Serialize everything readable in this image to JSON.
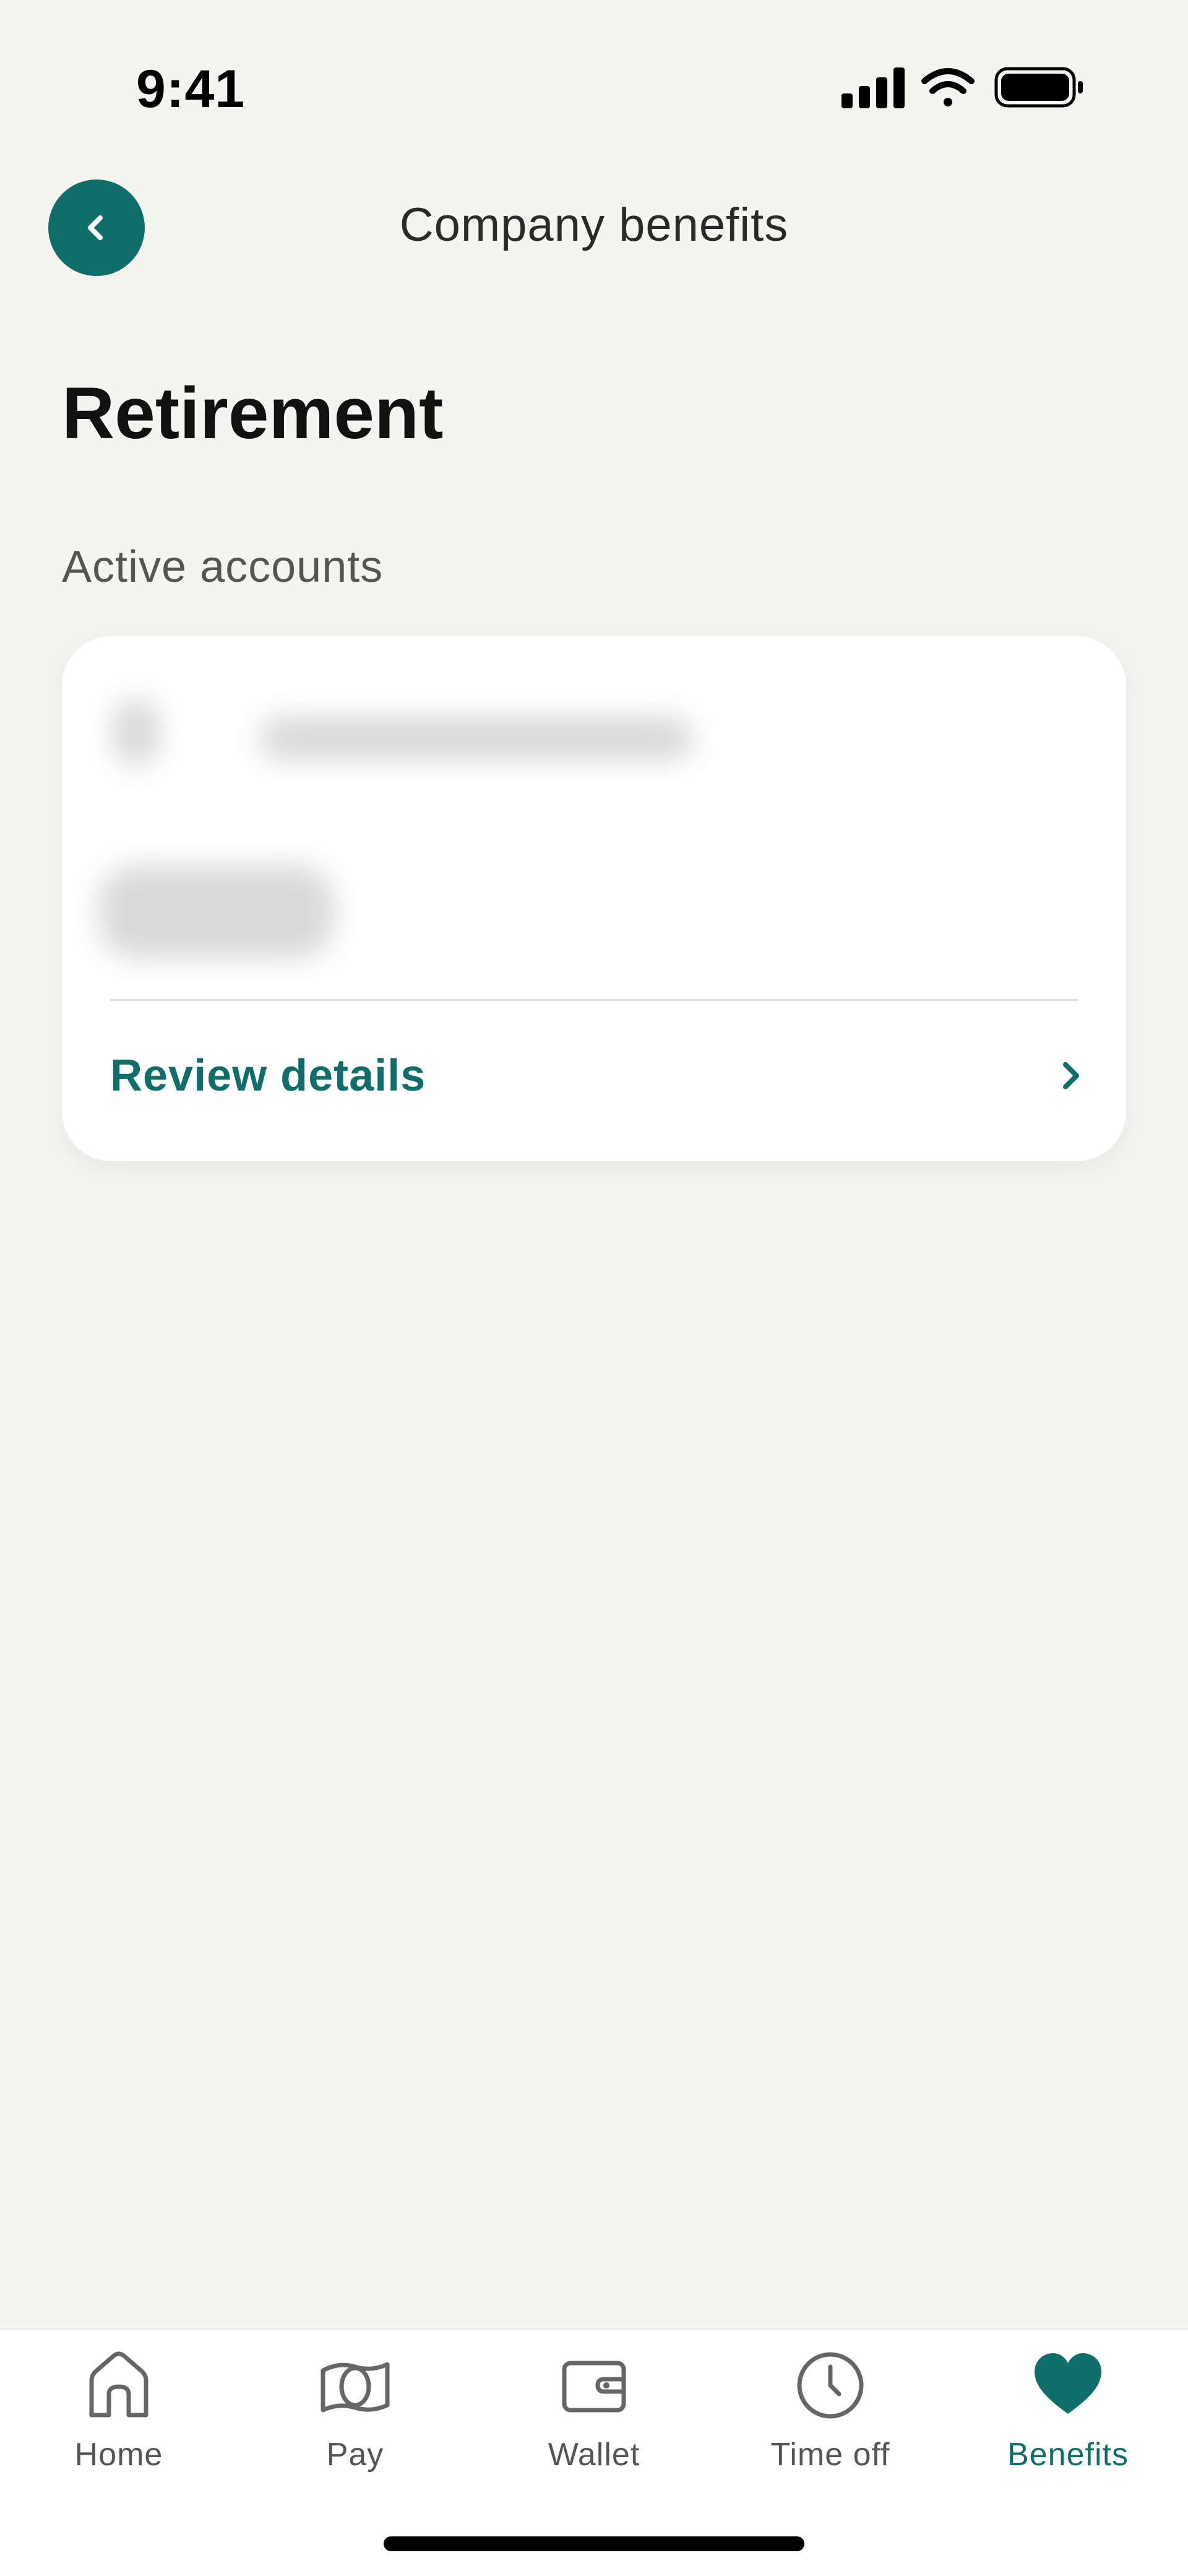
{
  "status_bar": {
    "time": "9:41",
    "icons": [
      "signal-icon",
      "wifi-icon",
      "battery-icon"
    ]
  },
  "header": {
    "title": "Company benefits",
    "back_icon": "chevron-left-icon"
  },
  "page": {
    "title": "Retirement",
    "section_label": "Active accounts"
  },
  "account_card": {
    "review_label": "Review details",
    "review_icon": "chevron-right-icon"
  },
  "bottom_nav": {
    "items": [
      {
        "label": "Home",
        "icon": "home-icon"
      },
      {
        "label": "Pay",
        "icon": "pay-icon"
      },
      {
        "label": "Wallet",
        "icon": "wallet-icon"
      },
      {
        "label": "Time off",
        "icon": "clock-icon"
      },
      {
        "label": "Benefits",
        "icon": "heart-icon",
        "active": true
      }
    ]
  },
  "colors": {
    "accent": "#0f6e69",
    "background": "#f4f4f1",
    "card": "#ffffff",
    "muted_text": "#555555"
  }
}
